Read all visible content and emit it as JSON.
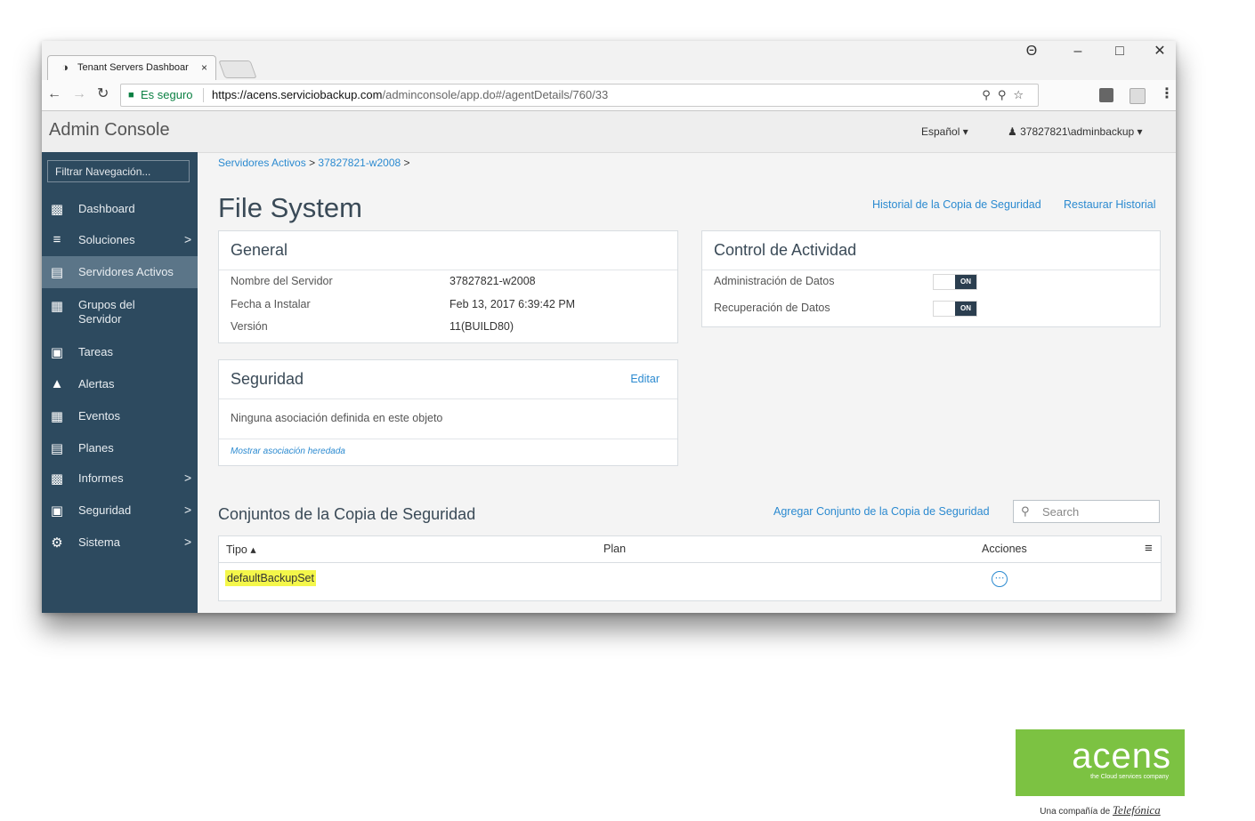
{
  "browser": {
    "tab_title": "Tenant Servers Dashboar",
    "tab_close": "×",
    "secure_label": "Es seguro",
    "url_host": "https://acens.serviciobackup.com",
    "url_path": "/adminconsole/app.do#/agentDetails/760/33",
    "window_controls": {
      "profile": "Θ",
      "minimize": "–",
      "maximize": "□",
      "close": "✕"
    }
  },
  "header": {
    "app_title": "Admin Console",
    "language": "Español ▾",
    "user": "37827821\\adminbackup ▾"
  },
  "sidebar": {
    "filter_placeholder": "Filtrar Navegación...",
    "items": [
      {
        "label": "Dashboard",
        "icon": "chart-icon"
      },
      {
        "label": "Soluciones",
        "icon": "layers-icon",
        "chevron": ">"
      },
      {
        "label": "Servidores Activos",
        "icon": "server-icon",
        "active": true
      },
      {
        "label": "Grupos del Servidor",
        "icon": "server-group-icon"
      },
      {
        "label": "Tareas",
        "icon": "briefcase-icon"
      },
      {
        "label": "Alertas",
        "icon": "warning-icon"
      },
      {
        "label": "Eventos",
        "icon": "events-icon"
      },
      {
        "label": "Planes",
        "icon": "document-icon"
      },
      {
        "label": "Informes",
        "icon": "report-icon",
        "chevron": ">"
      },
      {
        "label": "Seguridad",
        "icon": "lock-icon",
        "chevron": ">"
      },
      {
        "label": "Sistema",
        "icon": "gear-icon",
        "chevron": ">"
      }
    ]
  },
  "breadcrumb": {
    "item1": "Servidores Activos",
    "sep": ">",
    "item2": "37827821-w2008"
  },
  "page": {
    "title": "File System",
    "link_history": "Historial de la Copia de Seguridad",
    "link_restore": "Restaurar Historial"
  },
  "general": {
    "title": "General",
    "rows": [
      {
        "label": "Nombre del Servidor",
        "value": "37827821-w2008"
      },
      {
        "label": "Fecha a Instalar",
        "value": "Feb 13, 2017 6:39:42 PM"
      },
      {
        "label": "Versión",
        "value": "11(BUILD80)"
      }
    ]
  },
  "activity": {
    "title": "Control de Actividad",
    "rows": [
      {
        "label": "Administración de Datos",
        "state": "ON"
      },
      {
        "label": "Recuperación de Datos",
        "state": "ON"
      }
    ]
  },
  "security": {
    "title": "Seguridad",
    "edit": "Editar",
    "empty": "Ninguna asociación definida en este objeto",
    "inherited": "Mostrar asociación heredada"
  },
  "backupsets": {
    "title": "Conjuntos de la Copia de Seguridad",
    "add": "Agregar Conjunto de la Copia de Seguridad",
    "search_placeholder": "Search",
    "columns": {
      "type": "Tipo ▴",
      "plan": "Plan",
      "actions": "Acciones"
    },
    "rows": [
      {
        "type": "defaultBackupSet",
        "plan": ""
      }
    ]
  },
  "logo": {
    "brand": "acens",
    "tagline": "the Cloud services company",
    "sub_prefix": "Una compañía de",
    "sub_brand": "Telefónica"
  },
  "colors": {
    "sidebar": "#2d4a5f",
    "active": "#5b7588",
    "link": "#2b8ad0",
    "logo": "#7cc242",
    "highlight": "#f4f74a"
  }
}
